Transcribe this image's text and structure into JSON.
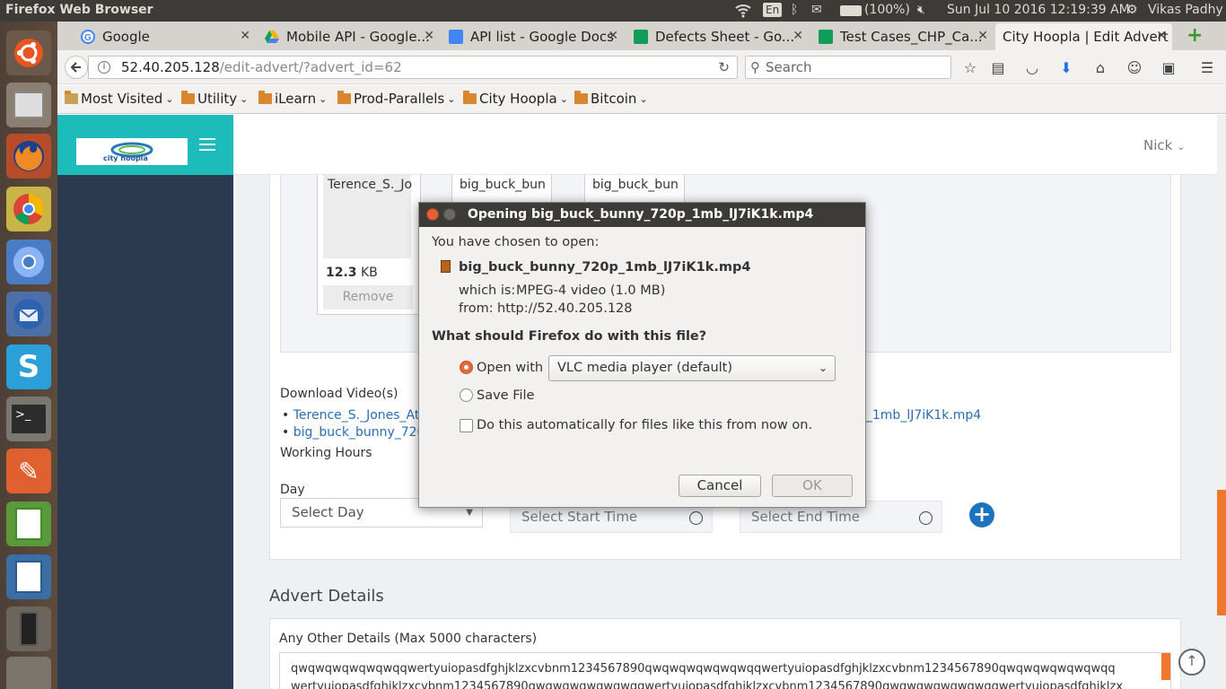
{
  "system": {
    "app_title": "Firefox Web Browser",
    "keyboard_layout": "En",
    "battery": "(100%)",
    "datetime": "Sun Jul 10 2016 12:19:39 AM",
    "user": "Vikas Padhy"
  },
  "tabs": [
    {
      "label": "Google",
      "color": "#4285f4"
    },
    {
      "label": "Mobile API - Google...",
      "color": "#f4b400"
    },
    {
      "label": "API list - Google Docs",
      "color": "#4285f4"
    },
    {
      "label": "Defects Sheet - Go...",
      "color": "#0f9d58"
    },
    {
      "label": "Test Cases_CHP_Ca...",
      "color": "#0f9d58"
    },
    {
      "label": "City Hoopla | Edit Advert",
      "color": "#1ebbbb"
    }
  ],
  "navbar": {
    "url_host": "52.40.205.128",
    "url_path": "/edit-advert/?advert_id=62",
    "search_placeholder": "Search"
  },
  "bookmarks": [
    "Most Visited",
    "Utility",
    "iLearn",
    "Prod-Parallels",
    "City Hoopla",
    "Bitcoin"
  ],
  "page": {
    "logo_text": "city hoopla",
    "user_menu": "Nick",
    "files": [
      {
        "name": "Terence_S._Jo",
        "size": "12.3",
        "unit": "KB",
        "remove": "Remove"
      },
      {
        "name": "big_buck_bun"
      },
      {
        "name": "big_buck_bun"
      }
    ],
    "download_label": "Download Video(s)",
    "download_links": [
      "Terence_S._Jones_Atla",
      "big_buck_bunny_720p",
      "p_1mb_lJ7iK1k.mp4"
    ],
    "working_hours": "Working Hours",
    "day_label": "Day",
    "select_day": "Select Day",
    "start_time_placeholder": "Select Start Time",
    "end_time_placeholder": "Select End Time",
    "advert_details": "Advert Details",
    "other_details_label": "Any Other Details (Max 5000 characters)",
    "other_details_line1": "qwqwqwqwqwqwqqwertyuiopasdfghjklzxcvbnm1234567890qwqwqwqwqwqwqqwertyuiopasdfghjklzxcvbnm1234567890qwqwqwqwqwqwqq",
    "other_details_line2": "wertyuiopasdfghjklzxcvbnm1234567890qwqwqwqwqwqwqqwertyuiopasdfghjklzxcvbnm1234567890qwqwqwqwqwqwqqwertyuiopasdfghjklzx"
  },
  "dialog": {
    "title": "Opening big_buck_bunny_720p_1mb_lJ7iK1k.mp4",
    "chosen": "You have chosen to open:",
    "filename": "big_buck_bunny_720p_1mb_lJ7iK1k.mp4",
    "which_is_label": "which is:",
    "which_is_value": "MPEG-4 video (1.0 MB)",
    "from_label": "from:",
    "from_value": "http://52.40.205.128",
    "question": "What should Firefox do with this file?",
    "open_with": "Open with",
    "app": "VLC media player (default)",
    "save_file": "Save File",
    "auto": "Do this automatically for files like this from now on.",
    "cancel": "Cancel",
    "ok": "OK"
  }
}
